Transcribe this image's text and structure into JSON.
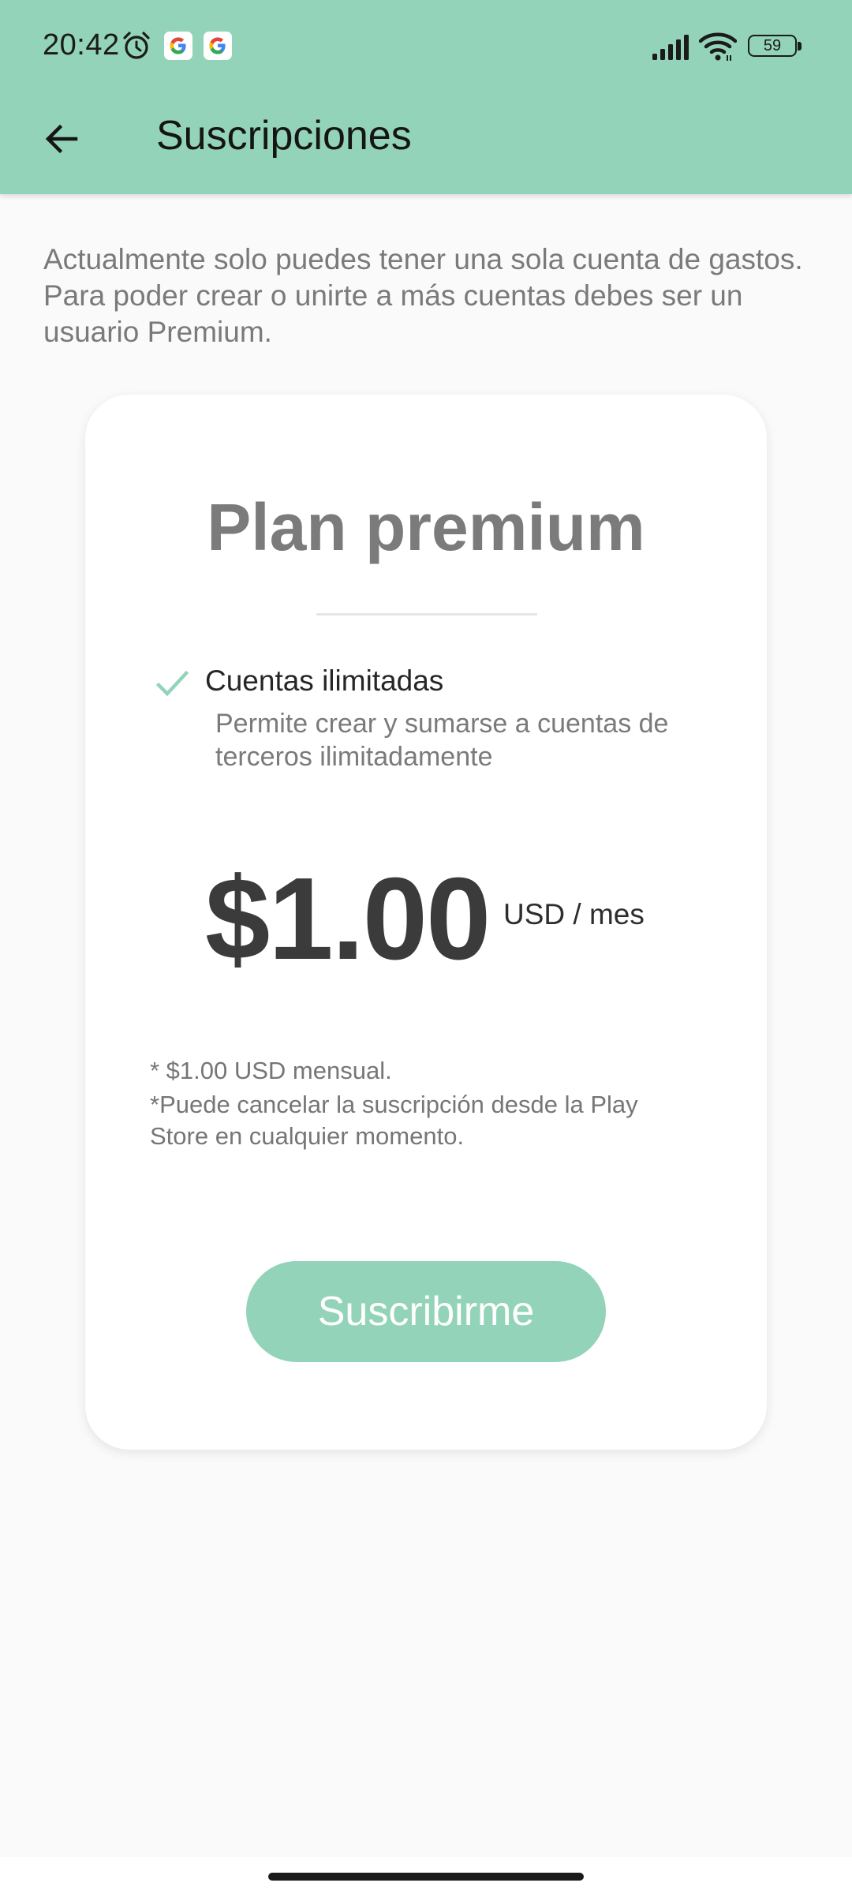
{
  "status_bar": {
    "time": "20:42",
    "battery": "59",
    "icons": [
      "alarm-icon",
      "google-icon",
      "google-icon",
      "signal-icon",
      "wifi-icon",
      "battery-icon"
    ]
  },
  "app_bar": {
    "title": "Suscripciones",
    "back_icon": "arrow-back-icon"
  },
  "intro_text": "Actualmente solo puedes tener una sola cuenta de gastos. Para poder crear o unirte a más cuentas debes ser un usuario Premium.",
  "plan_card": {
    "title": "Plan premium",
    "feature": {
      "icon": "check-icon",
      "title": "Cuentas ilimitadas",
      "description": "Permite crear y sumarse a cuentas de terceros ilimitadamente"
    },
    "price": "$1.00",
    "price_unit": "USD / mes",
    "note_1": "* $1.00 USD mensual.",
    "note_2": "*Puede cancelar la suscripción desde la Play Store en cualquier momento.",
    "subscribe_label": "Suscribirme"
  },
  "colors": {
    "accent": "#93d3b9",
    "background": "#fafafa",
    "card": "#ffffff"
  }
}
